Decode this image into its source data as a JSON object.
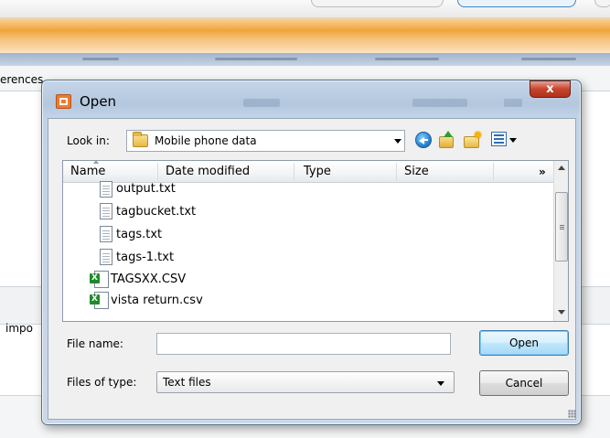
{
  "background": {
    "left_label_top": "erences",
    "left_label_bottom": "impo"
  },
  "dialog": {
    "title": "Open",
    "close_symbol": "x",
    "icons": {
      "title": "open-dialog-icon",
      "close": "close-icon",
      "look_in_folder": "folder-icon",
      "back": "back-arrow-icon",
      "up": "up-folder-icon",
      "new_folder": "new-folder-icon",
      "views": "views-icon",
      "text_file": "text-file-icon",
      "csv_file": "excel-csv-icon"
    },
    "look_in": {
      "label": "Look in:",
      "value": "Mobile phone data"
    },
    "columns": [
      "Name",
      "Date modified",
      "Type",
      "Size"
    ],
    "more_columns": "»",
    "files": [
      {
        "name": "output.txt",
        "icon": "text-file-icon"
      },
      {
        "name": "tagbucket.txt",
        "icon": "text-file-icon"
      },
      {
        "name": "tags.txt",
        "icon": "text-file-icon"
      },
      {
        "name": "tags-1.txt",
        "icon": "text-file-icon"
      },
      {
        "name": "TAGSXX.CSV",
        "icon": "excel-csv-icon"
      },
      {
        "name": "vista return.csv",
        "icon": "excel-csv-icon"
      }
    ],
    "file_name": {
      "label": "File name:",
      "value": "",
      "placeholder": ""
    },
    "file_type": {
      "label": "Files of type:",
      "value": "Text files"
    },
    "buttons": {
      "open": "Open",
      "cancel": "Cancel"
    },
    "colors": {
      "accent": "#3c7fb1",
      "frame": "#b3c7de",
      "close": "#c7432c",
      "app_orange": "#f1a43a"
    }
  }
}
